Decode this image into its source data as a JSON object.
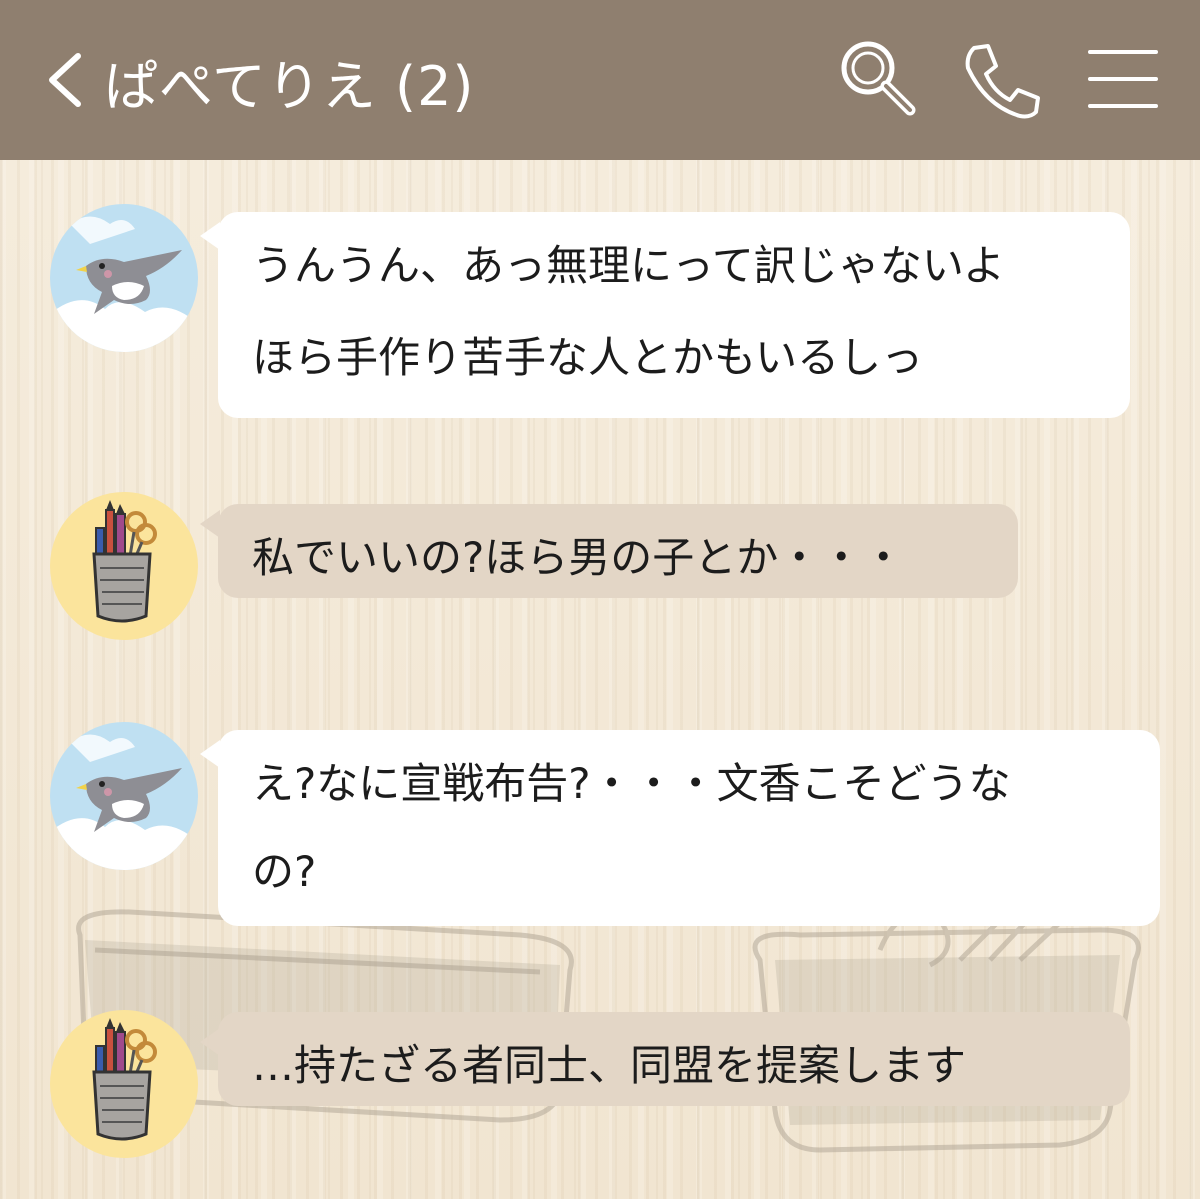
{
  "header": {
    "title": "ぱぺてりえ (2)",
    "back_icon": "chevron-left-icon",
    "search_icon": "search-icon",
    "phone_icon": "phone-icon",
    "menu_icon": "hamburger-menu-icon",
    "bg_color": "#8f7f6f"
  },
  "messages": [
    {
      "sender_avatar": "swallow-bird-avatar",
      "style": "white",
      "lines": [
        "うんうん、あっ無理にって訳じゃないよ",
        "ほら手作り苦手な人とかもいるしっ"
      ]
    },
    {
      "sender_avatar": "pencil-cup-avatar",
      "style": "tan",
      "lines": [
        "私でいいの?ほら男の子とか・・・"
      ]
    },
    {
      "sender_avatar": "swallow-bird-avatar",
      "style": "white",
      "lines": [
        "え?なに宣戦布告?・・・文香こそどうな",
        "の?"
      ]
    },
    {
      "sender_avatar": "pencil-cup-avatar",
      "style": "tan",
      "lines": [
        "…持たざる者同士、同盟を提案します"
      ]
    }
  ],
  "colors": {
    "background": "#f3e9d8",
    "bubble_white": "#ffffff",
    "bubble_tan": "#e3d6c6",
    "bird_avatar_bg": "#bfe0f2",
    "pen_avatar_bg": "#fbe49c"
  }
}
